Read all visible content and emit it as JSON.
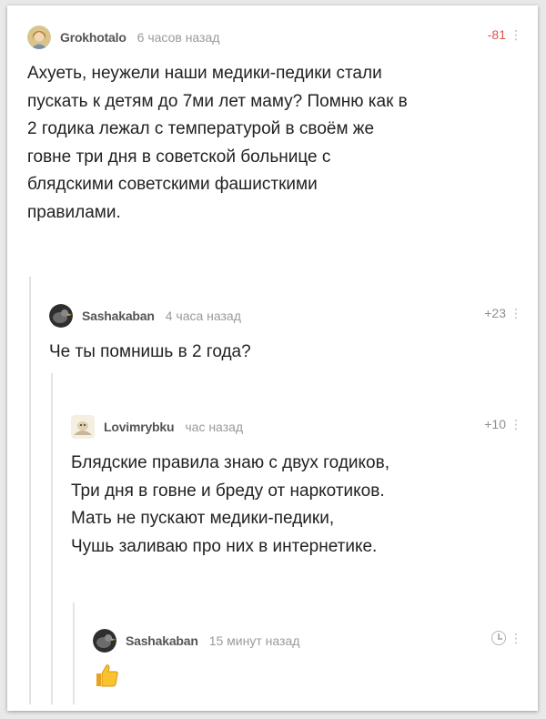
{
  "comments": [
    {
      "author": "Grokhotalo",
      "time": "6 часов назад",
      "rating": "-81",
      "more_glyph": "⋮",
      "avatar_icon": "girl-portrait-icon",
      "text": [
        "Ахуеть, неужели наши медики-педики стали",
        "пускать к детям до 7ми лет маму? Помню как в",
        "2 годика лежал с температурой в своём же",
        "говне три дня в советской больнице с",
        "блядскими советскими фашисткими",
        "правилами."
      ]
    },
    {
      "author": "Sashakaban",
      "time": "4 часа назад",
      "rating": "+23",
      "more_glyph": "⋮",
      "avatar_icon": "bird-avatar-icon",
      "text": [
        "Че ты помнишь в 2 года?"
      ]
    },
    {
      "author": "Lovimrybku",
      "time": "час назад",
      "rating": "+10",
      "more_glyph": "⋮",
      "avatar_icon": "fishing-avatar-icon",
      "text": [
        "Блядские правила знаю с двух годиков,",
        "Три дня в говне и бреду от наркотиков.",
        "Мать не пускают медики-педики,",
        "Чушь заливаю про них в интернетике."
      ]
    },
    {
      "author": "Sashakaban",
      "time": "15 минут назад",
      "more_glyph": "⋮",
      "avatar_icon": "bird-avatar-icon",
      "status_icon": "clock-icon",
      "reaction_icon": "thumbs-up-icon"
    }
  ],
  "colors": {
    "negative_rating": "#d9534f",
    "neutral_rating": "#8f8f8f",
    "thread_line": "#e3e3e3"
  }
}
